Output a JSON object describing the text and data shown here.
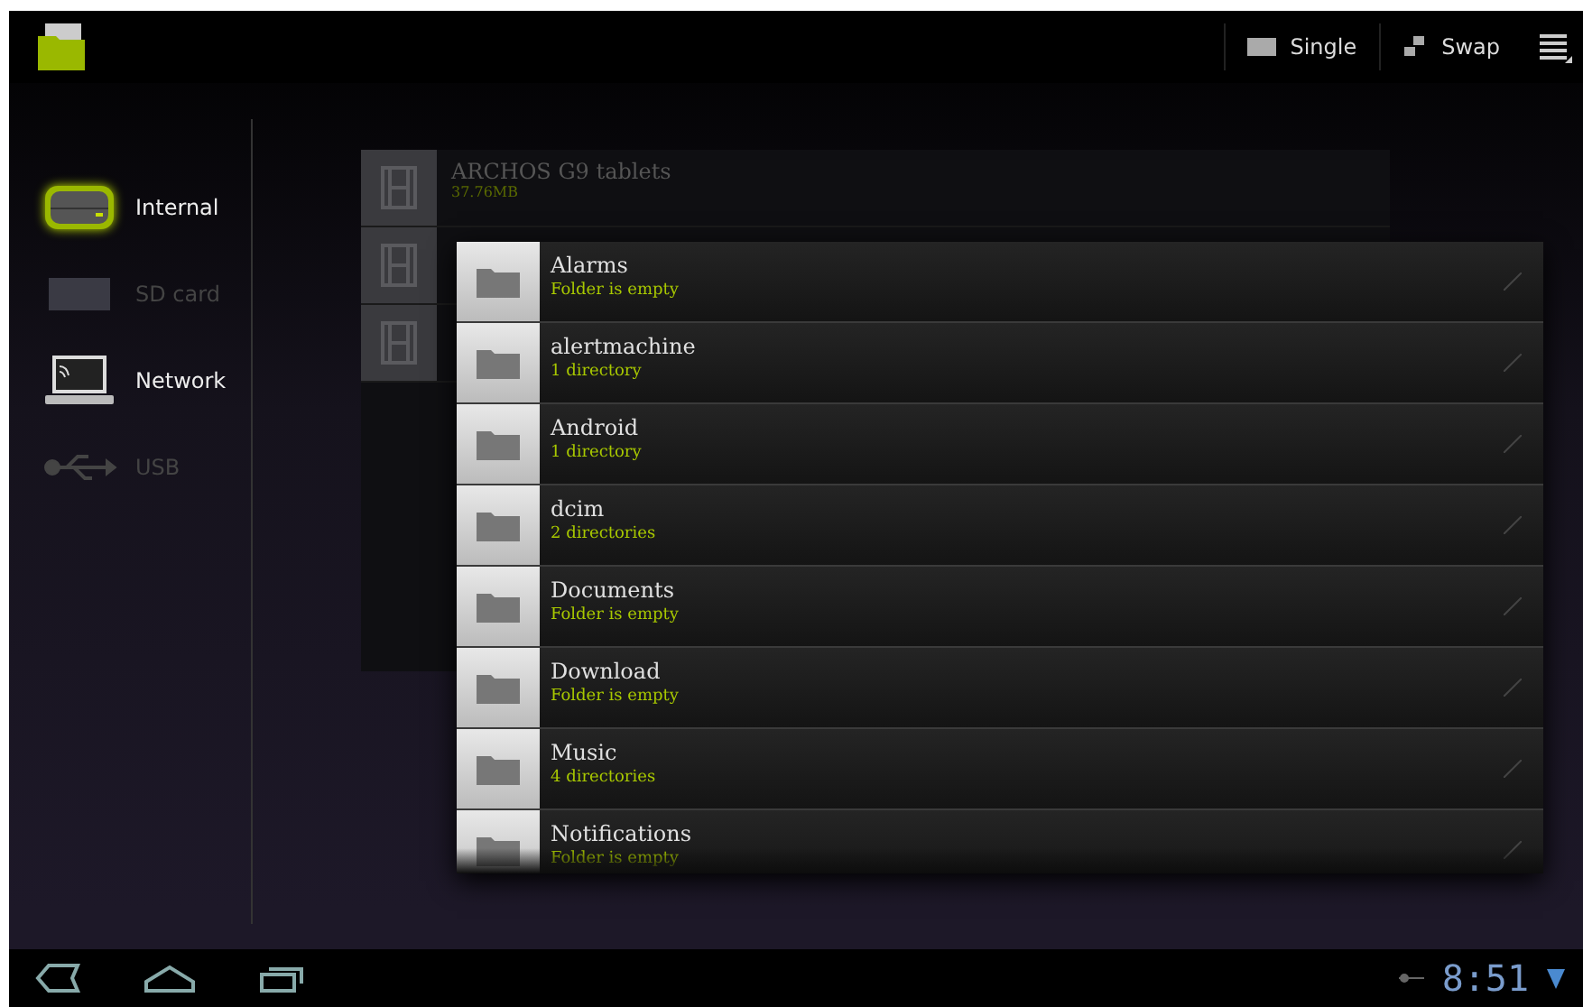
{
  "action_bar": {
    "actions": [
      {
        "kind": "single",
        "label": "Single"
      },
      {
        "kind": "swap",
        "label": "Swap"
      },
      {
        "kind": "menu"
      }
    ]
  },
  "sidebar": {
    "items": [
      {
        "kind": "internal",
        "label": "Internal",
        "selected": true,
        "disabled": false
      },
      {
        "kind": "sdcard",
        "label": "SD card",
        "selected": false,
        "disabled": true
      },
      {
        "kind": "network",
        "label": "Network",
        "selected": false,
        "disabled": false
      },
      {
        "kind": "usb",
        "label": "USB",
        "selected": false,
        "disabled": true
      }
    ]
  },
  "background_files": [
    {
      "kind": "file",
      "name": "ARCHOS G9 tablets",
      "size": "37.76MB"
    },
    {
      "kind": "covered"
    },
    {
      "kind": "covered"
    }
  ],
  "folder_popup": {
    "folders": [
      {
        "name": "Alarms",
        "detail": "Folder is empty"
      },
      {
        "name": "alertmachine",
        "detail": "1 directory"
      },
      {
        "name": "Android",
        "detail": "1 directory"
      },
      {
        "name": "dcim",
        "detail": "2 directories"
      },
      {
        "name": "Documents",
        "detail": "Folder is empty"
      },
      {
        "name": "Download",
        "detail": "Folder is empty"
      },
      {
        "name": "Music",
        "detail": "4 directories"
      },
      {
        "name": "Notifications",
        "detail": "Folder is empty"
      }
    ]
  },
  "system_bar": {
    "time": "8:51"
  }
}
